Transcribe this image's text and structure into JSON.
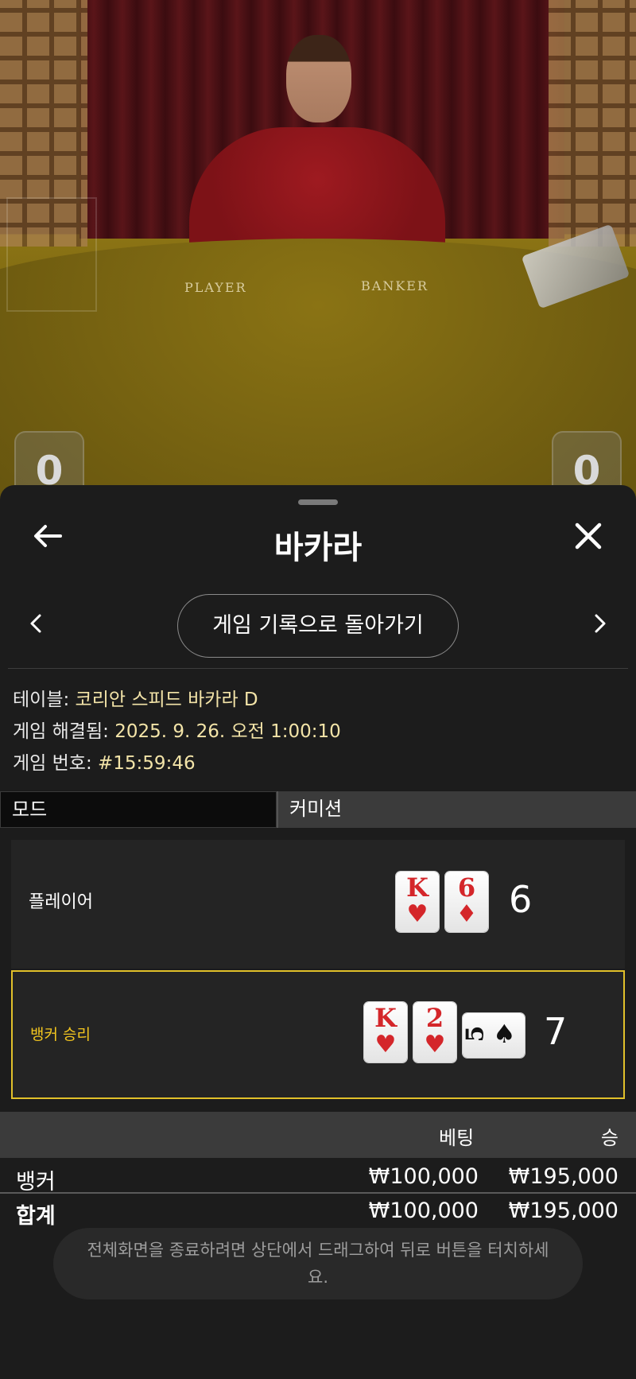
{
  "video": {
    "felt_player_label": "PLAYER",
    "felt_banker_label": "BANKER",
    "player_score": "0",
    "banker_score": "0"
  },
  "header": {
    "title": "바카라",
    "back_icon": "arrow-left-icon",
    "close_icon": "close-icon"
  },
  "history_button_label": "게임 기록으로 돌아가기",
  "info": {
    "table_label": "테이블:",
    "table_value": "코리안 스피드 바카라 D",
    "resolved_label": "게임 해결됨:",
    "resolved_value": "2025. 9. 26. 오전 1:00:10",
    "number_label": "게임 번호:",
    "number_value": "#15:59:46"
  },
  "tabs": {
    "mode": "모드",
    "commission": "커미션"
  },
  "hands": {
    "player": {
      "label": "플레이어",
      "total": "6",
      "cards": [
        {
          "rank": "K",
          "suit": "♥"
        },
        {
          "rank": "6",
          "suit": "♦"
        }
      ]
    },
    "banker": {
      "label": "뱅커 승리",
      "total": "7",
      "cards": [
        {
          "rank": "K",
          "suit": "♥"
        },
        {
          "rank": "2",
          "suit": "♥"
        }
      ],
      "third_card": {
        "rank": "5",
        "suit": "♠"
      }
    }
  },
  "bets": {
    "col_bet": "베팅",
    "col_win": "승",
    "rows": [
      {
        "name": "뱅커",
        "bet": "₩100,000",
        "win": "₩195,000"
      },
      {
        "name": "합계",
        "bet": "₩100,000",
        "win": "₩195,000"
      }
    ]
  },
  "toast": "전체화면을 종료하려면 상단에서 드래그하여 뒤로 버튼을 터치하세요.",
  "colors": {
    "accent_win": "#f2c51f",
    "info_value": "#f3e4a8",
    "card_red": "#d4262a"
  }
}
